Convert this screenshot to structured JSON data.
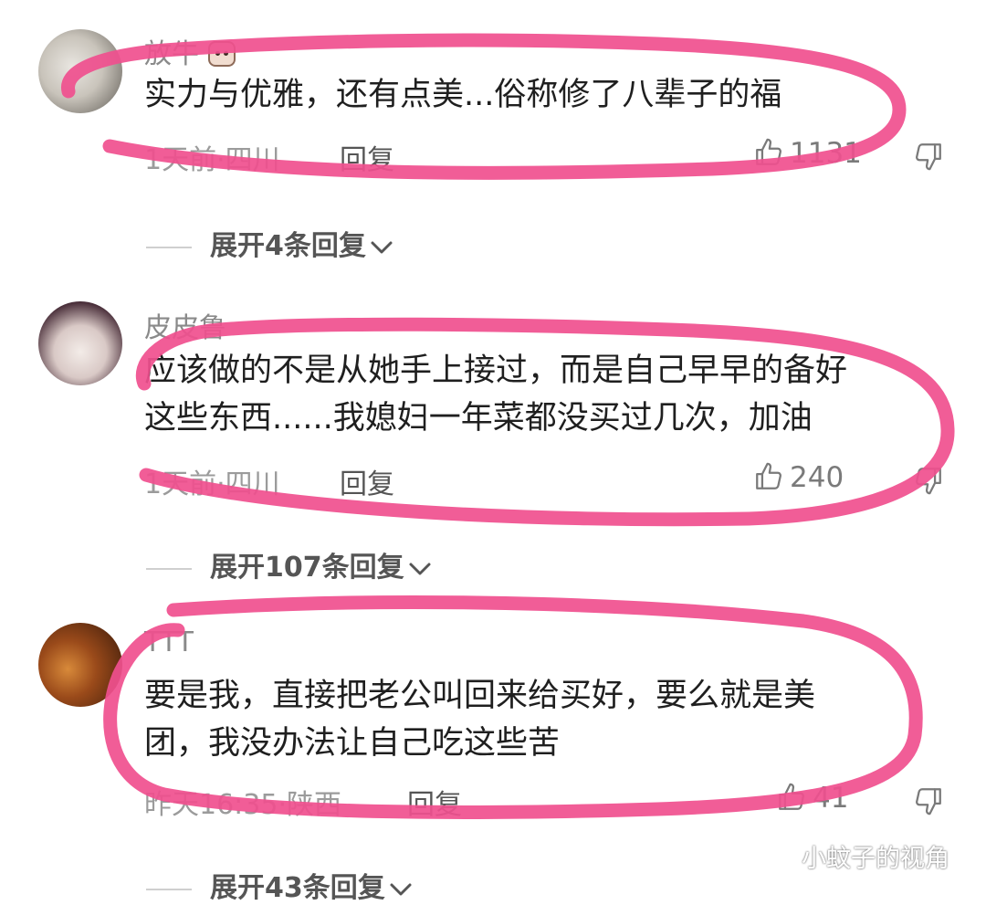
{
  "comments": [
    {
      "username": "放牛",
      "badge_icon": "cow-emoji-icon",
      "text_lines": [
        "实力与优雅，还有点美...俗称修了八辈子的福"
      ],
      "meta": "1天前·四川",
      "reply_label": "回复",
      "likes": "1131",
      "expand_label": "展开4条回复"
    },
    {
      "username": "皮皮鲁",
      "text_lines": [
        "应该做的不是从她手上接过，而是自己早早的备好",
        "这些东西......我媳妇一年菜都没买过几次，加油"
      ],
      "meta": "1天前·四川",
      "reply_label": "回复",
      "likes": "240",
      "expand_label": "展开107条回复"
    },
    {
      "username": "TTT",
      "text_lines": [
        "要是我，直接把老公叫回来给买好，要么就是美",
        "团，我没办法让自己吃这些苦"
      ],
      "meta": "昨天16:35·陕西",
      "reply_label": "回复",
      "likes": "41",
      "expand_label": "展开43条回复"
    }
  ],
  "watermark": "小蚊子的视角",
  "colors": {
    "highlight_marker": "#f0508f",
    "text": "#1f1f1f",
    "muted": "#9b9b9b",
    "expand": "#555555"
  }
}
